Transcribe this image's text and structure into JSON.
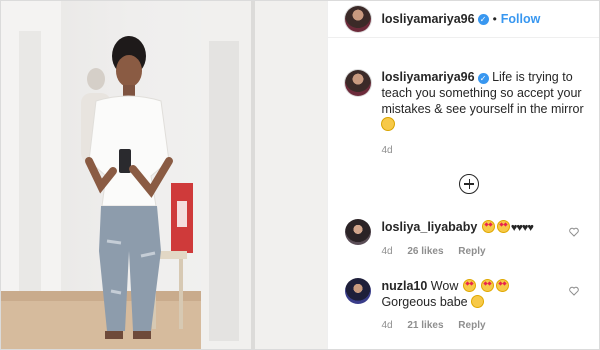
{
  "post": {
    "author": "losliyamariya96",
    "follow_label": "Follow",
    "separator": "•",
    "caption": "Life is trying to teach you something so accept your mistakes & see yourself in the mirror",
    "caption_time": "4d",
    "add_comment_icon": "plus-circle-icon"
  },
  "comments": [
    {
      "user": "losliya_liyababy",
      "text_suffix": "♥♥♥♥",
      "time": "4d",
      "likes": "26 likes",
      "reply": "Reply"
    },
    {
      "user": "nuzla10",
      "text_prefix": "Wow",
      "text_suffix": "Gorgeous babe",
      "time": "4d",
      "likes": "21 likes",
      "reply": "Reply"
    }
  ],
  "colors": {
    "accent": "#3897f0",
    "muted": "#8e8e8e",
    "text": "#262626",
    "border": "#dbdbdb"
  }
}
